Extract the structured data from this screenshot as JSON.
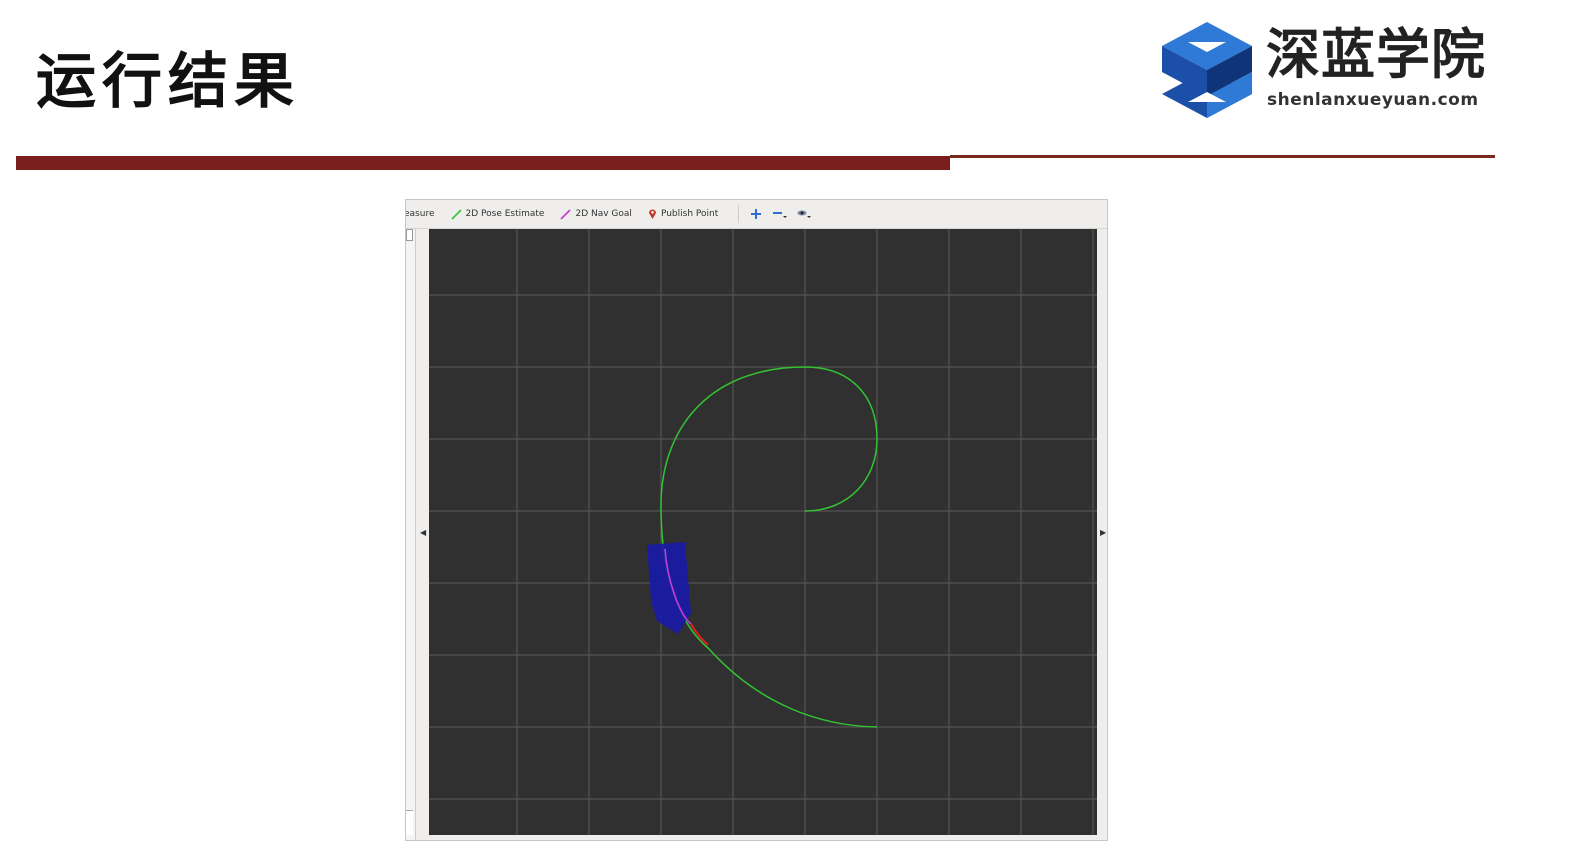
{
  "slide": {
    "title": "运行结果"
  },
  "logo": {
    "name_cn": "深蓝学院",
    "url_text": "shenlanxueyuan.com",
    "colors": {
      "primary": "#1b4fa8",
      "light": "#2e7ad6",
      "dark": "#0f3578"
    }
  },
  "colors": {
    "rule_thick": "#7a1f1c",
    "rule_thin": "#7a2a1c",
    "viewport_bg": "#303030",
    "grid": "#6a6a6a",
    "path_green": "#33c433",
    "path_red": "#e01f1f",
    "path_magenta": "#c83cd0",
    "robot_blue": "#1a1aa8"
  },
  "rviz": {
    "toolbar": {
      "measure_label": "easure",
      "pose_estimate_label": "2D Pose Estimate",
      "nav_goal_label": "2D Nav Goal",
      "publish_point_label": "Publish Point"
    },
    "icons": {
      "pose_estimate": "green-arrow-icon",
      "nav_goal": "magenta-arrow-icon",
      "publish_point": "map-pin-icon",
      "move_camera": "move-camera-icon",
      "zoom_out": "minus-icon",
      "camera_type": "eye-icon",
      "collapse_left": "triangle-left-icon",
      "collapse_right": "triangle-right-icon"
    }
  }
}
